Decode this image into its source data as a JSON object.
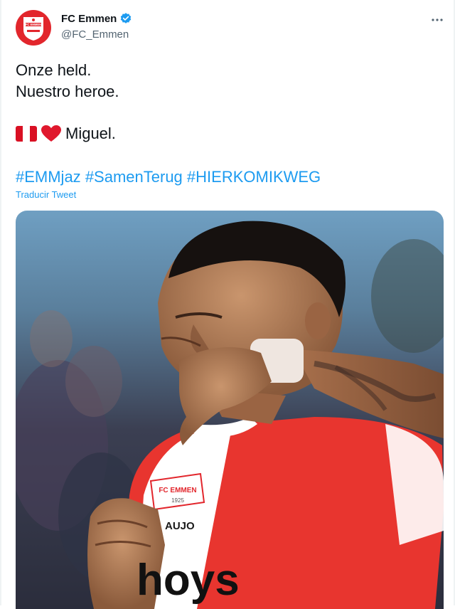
{
  "author": {
    "display_name": "FC Emmen",
    "handle": "@FC_Emmen",
    "verified": true,
    "crest_text": "FC EMMEN"
  },
  "menu": {
    "icon": "more-horizontal-icon"
  },
  "tweet": {
    "line1": "Onze held.",
    "line2": "Nuestro heroe.",
    "line3_text": "Miguel.",
    "emojis": [
      "peru-flag-icon",
      "red-heart-icon"
    ],
    "hashtags": [
      "#EMMjaz",
      "#SamenTerug",
      "#HIERKOMIKWEG"
    ],
    "translate_label": "Traducir Tweet"
  },
  "media": {
    "badge_lines": [
      "FC EMMEN",
      "1925"
    ],
    "shirt_name": "AUJO",
    "sponsor_text": "hoys"
  },
  "colors": {
    "accent": "#1d9bf0",
    "club_red": "#e2262c",
    "text": "#0f1419",
    "secondary_text": "#536471"
  }
}
